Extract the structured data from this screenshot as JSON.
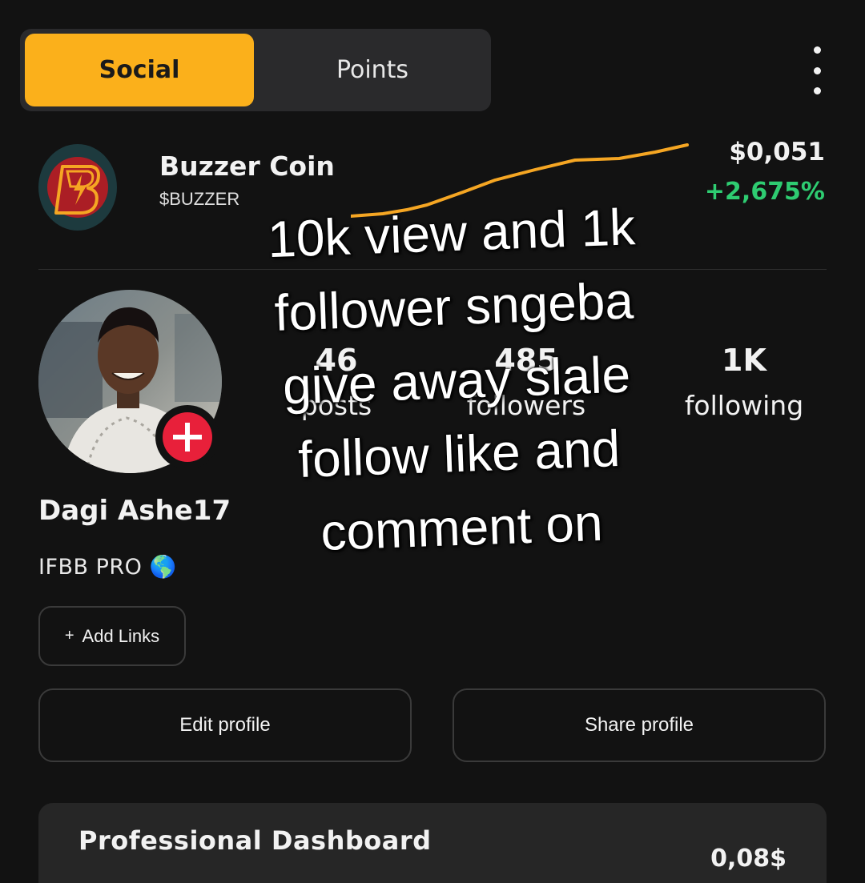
{
  "tabs": {
    "social_label": "Social",
    "points_label": "Points",
    "active": "Social"
  },
  "menu": {
    "icon": "more-vertical-icon"
  },
  "coin": {
    "name": "Buzzer Coin",
    "ticker": "$BUZZER",
    "price": "$0,051",
    "change": "+2,675%",
    "change_color": "#2ecc71",
    "logo_icon": "buzzer-lightning-logo",
    "trend_color": "#f5a623"
  },
  "profile": {
    "name": "Dagi Ashe17",
    "bio": "IFBB PRO 🌎",
    "stats": [
      {
        "value": "46",
        "label": "posts"
      },
      {
        "value": "485",
        "label": "followers"
      },
      {
        "value": "1K",
        "label": "following"
      }
    ]
  },
  "actions": {
    "add_links": "Add Links",
    "edit_profile": "Edit profile",
    "share_profile": "Share profile"
  },
  "dashboard": {
    "title": "Professional Dashboard",
    "value": "0,08$"
  },
  "overlay_caption": "10k view and 1k follower sngeba give away slale follow like and comment on",
  "colors": {
    "accent": "#fbb01b",
    "background": "#121212"
  }
}
